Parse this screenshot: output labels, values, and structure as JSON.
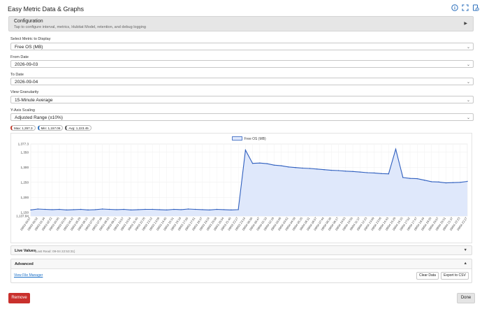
{
  "app": {
    "title": "Easy Metric Data & Graphs"
  },
  "header_icons": [
    "info-icon",
    "fullscreen-icon",
    "help-book-icon"
  ],
  "configuration": {
    "title": "Configuration",
    "subtitle": "Tap to configure interval, metrics, Hubitat Model, retention, and debug logging"
  },
  "fields": {
    "metric": {
      "label": "Select Metric to Display",
      "value": "Free OS (MB)"
    },
    "from_date": {
      "label": "From Date",
      "value": "2026-09-03"
    },
    "to_date": {
      "label": "To Date",
      "value": "2026-09-04"
    },
    "granularity": {
      "label": "View Granularity",
      "value": "15-Minute Average"
    },
    "y_scaling": {
      "label": "Y-Axis Scaling",
      "value": "Adjusted Range (±10%)"
    }
  },
  "stats": {
    "max": "Max: 1,357.3",
    "min": "Min: 1,157.06",
    "avg": "Avg: 1,223.45"
  },
  "colors": {
    "line": "#2f5fbf",
    "fill": "#dfe8fb",
    "grid": "#ececec",
    "remove": "#c9302c"
  },
  "chart_data": {
    "type": "area",
    "title": "",
    "xlabel": "",
    "ylabel": "",
    "legend_position": "top",
    "grid": true,
    "ylim": [
      1137.84,
      1377.3
    ],
    "y_ticks": [
      1137.84,
      1150,
      1200,
      1250,
      1300,
      1350,
      1377.3
    ],
    "y_tick_labels": [
      "1,137.84",
      "1,150",
      "1,200",
      "1,250",
      "1,300",
      "1,350",
      "1,377.3"
    ],
    "x": [
      "09/03 00:07",
      "09/03 00:52",
      "09/03 01:34",
      "09/03 02:22",
      "09/03 03:05",
      "09/03 03:56",
      "09/03 04:42",
      "09/03 05:29",
      "09/03 06:15",
      "09/03 07:00",
      "09/03 07:49",
      "09/03 08:33",
      "09/03 09:21",
      "09/03 10:07",
      "09/03 10:54",
      "09/03 11:40",
      "09/03 12:26",
      "09/03 13:12",
      "09/03 13:59",
      "09/03 14:45",
      "09/03 15:31",
      "09/03 16:18",
      "09/03 17:05",
      "09/03 17:51",
      "09/03 18:37",
      "09/03 19:24",
      "09/03 20:08",
      "09/03 20:54",
      "09/03 21:40",
      "09/03 22:27",
      "09/03 23:14",
      "09/04 00:00",
      "09/04 00:47",
      "09/04 01:33",
      "09/04 02:19",
      "09/04 03:06",
      "09/04 03:52",
      "09/04 04:38",
      "09/04 05:25",
      "09/04 06:11",
      "09/04 06:57",
      "09/04 07:44",
      "09/04 08:30",
      "09/04 09:17",
      "09/04 10:03",
      "09/04 10:50",
      "09/04 11:37",
      "09/04 12:23",
      "09/04 13:09",
      "09/04 13:56",
      "09/04 14:43",
      "09/04 15:29",
      "09/04 16:15",
      "09/04 17:02",
      "09/04 17:47",
      "09/04 18:34",
      "09/04 19:20",
      "09/04 20:07",
      "09/04 20:51",
      "09/04 21:37",
      "09/04 22:23",
      "09/04 22:27"
    ],
    "series": [
      {
        "name": "Free OS (MB)",
        "values": [
          1158,
          1161,
          1160,
          1159,
          1160,
          1158,
          1159,
          1160,
          1158,
          1159,
          1161,
          1160,
          1159,
          1160,
          1158,
          1159,
          1160,
          1160,
          1159,
          1158,
          1160,
          1159,
          1161,
          1160,
          1159,
          1158,
          1160,
          1159,
          1158,
          1159,
          1357,
          1313,
          1314,
          1312,
          1307,
          1305,
          1301,
          1299,
          1297,
          1296,
          1294,
          1292,
          1290,
          1289,
          1287,
          1286,
          1284,
          1282,
          1281,
          1279,
          1278,
          1360,
          1266,
          1263,
          1262,
          1257,
          1252,
          1251,
          1248,
          1249,
          1250,
          1253
        ]
      }
    ]
  },
  "live_values": {
    "title": "Live Values",
    "last_read": "(Last Read: 09-04 22:53:31)"
  },
  "advanced": {
    "title": "Advanced",
    "link": "View File Manager",
    "clear_btn": "Clear Data",
    "export_btn": "Export to CSV"
  },
  "footer": {
    "remove": "Remove",
    "done": "Done"
  }
}
